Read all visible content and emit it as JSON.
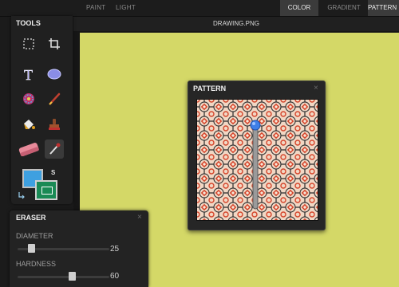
{
  "menu": {
    "paint": "PAINT",
    "light": "LIGHT"
  },
  "right_tabs": {
    "color": "COLOR",
    "gradient": "GRADIENT",
    "pattern": "PATTERN"
  },
  "document": {
    "title": "DRAWING.PNG"
  },
  "tools_panel": {
    "title": "TOOLS",
    "swap_label": "S"
  },
  "eraser_panel": {
    "title": "ERASER",
    "close": "×",
    "diameter_label": "DIAMETER",
    "diameter_value": "25",
    "diameter_fraction": 0.12,
    "hardness_label": "HARDNESS",
    "hardness_value": "60",
    "hardness_fraction": 0.6
  },
  "pattern_panel": {
    "title": "PATTERN",
    "close": "×"
  },
  "colors": {
    "canvas_bg": "#d4d867",
    "primary": "#3ea0e0",
    "secondary": "#1a8a55",
    "pattern_base": "#f1d7c4",
    "pattern_red": "#d5442a"
  }
}
